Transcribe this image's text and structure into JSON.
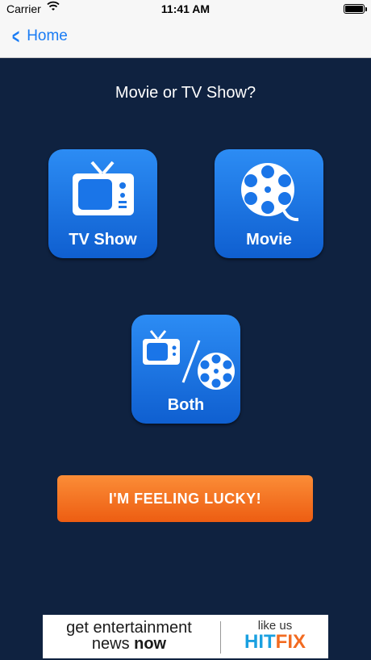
{
  "status_bar": {
    "carrier": "Carrier",
    "time": "11:41 AM"
  },
  "nav": {
    "back_label": "Home"
  },
  "prompt": "Movie or TV Show?",
  "tiles": {
    "tv_show": "TV Show",
    "movie": "Movie",
    "both": "Both"
  },
  "lucky_button": "I'M FEELING LUCKY!",
  "ad": {
    "line1": "get entertainment",
    "line2a": "news ",
    "line2b": "now",
    "like_us": "like us",
    "brand_a": "HIT",
    "brand_b": "FIX"
  },
  "colors": {
    "background": "#0f2240",
    "tile": "#1a75e8",
    "lucky": "#f47421",
    "link": "#1a7cf4"
  }
}
